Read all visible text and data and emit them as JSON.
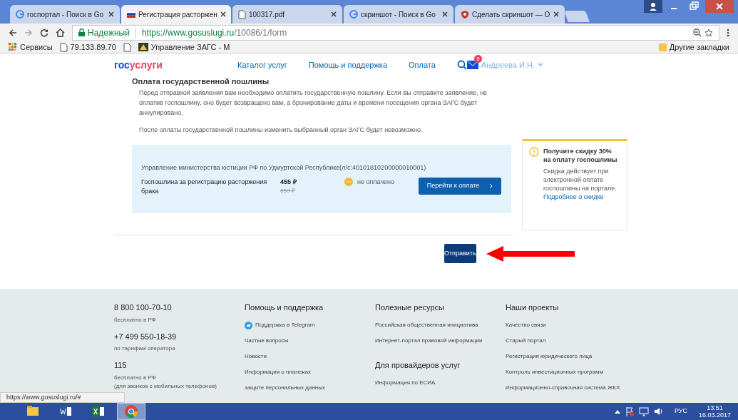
{
  "browser": {
    "tabs": [
      {
        "title": "госпортал - Поиск в Go",
        "kind": "google",
        "selected": false
      },
      {
        "title": "Регистрация расторжен",
        "kind": "flag",
        "selected": true
      },
      {
        "title": "100317.pdf",
        "kind": "file",
        "selected": false
      },
      {
        "title": "скриншот - Поиск в Go",
        "kind": "google",
        "selected": false
      },
      {
        "title": "Сделать скриншот — О",
        "kind": "shield",
        "selected": false
      }
    ],
    "address": {
      "secure_label": "Надежный",
      "url_host": "https://www.gosuslugi.ru",
      "url_path": "/10086/1/form"
    },
    "bookmarks": [
      {
        "label": "Сервисы",
        "kind": "apps"
      },
      {
        "label": "79.133.89.70",
        "kind": "file"
      },
      {
        "kind": "blank"
      },
      {
        "label": "Управление ЗАГС - М",
        "kind": "emblem"
      }
    ],
    "other_bookmarks": "Другие закладки"
  },
  "header": {
    "logo_a": "гос",
    "logo_b": "услуги",
    "nav": [
      "Каталог услуг",
      "Помощь и поддержка",
      "Оплата"
    ],
    "badge": "9",
    "user": "Андреева И.Н."
  },
  "section": {
    "heading": "Оплата государственной пошлины",
    "paragraphs": [
      "Перед отправкой заявления вам необходимо оплатить государственную пошлину. Если вы отправите заявление, не оплатив госпошлину, оно будет возвращено вам, а бронирование даты и времени посещения органа ЗАГС будет аннулировано.",
      "После оплаты государственной пошлины изменить выбранный орган ЗАГС будет невозможно."
    ],
    "payment": {
      "recipient": "Управление министерства юстиции РФ по Удмуртской Республике(л/с:40101810200000010001)",
      "item": "Госпошлина за регистрацию расторжения брака",
      "price": "455 ₽",
      "old_price": "650 ₽",
      "status": "не оплачено",
      "paid": false,
      "pay_button": "Перейти к оплате"
    },
    "discount": {
      "title": "Получите скидку 30% на оплату госпошлины",
      "text": "Скидка действует при электронной оплате госпошлины на портале.",
      "link": "Подробнее о скидке"
    },
    "submit": "Отправить"
  },
  "footer": {
    "contacts": [
      {
        "phone": "8 800 100-70-10",
        "note": "бесплатно в РФ"
      },
      {
        "phone": "+7 499 550-18-39",
        "note": "по тарифам оператора"
      },
      {
        "phone": "115",
        "note": "бесплатно в РФ",
        "note2": "(для звонков с мобильных телефонов)"
      }
    ],
    "columns": [
      {
        "title": "Помощь и поддержка",
        "links": [
          {
            "label": "Поддержка в Telegram",
            "kind": "telegram"
          },
          {
            "label": "Частые вопросы"
          },
          {
            "label": "Новости"
          },
          {
            "label": "Информация о платежах"
          },
          {
            "label": "защите персональных данных"
          }
        ]
      },
      {
        "title": "Полезные ресурсы",
        "links": [
          {
            "label": "Российская общественная инициатива"
          },
          {
            "label": "Интернет-портал правовой информации"
          }
        ],
        "title2": "Для провайдеров услуг",
        "links2": [
          {
            "label": "Информация по ЕСИА"
          }
        ]
      },
      {
        "title": "Наши проекты",
        "links": [
          {
            "label": "Качество связи"
          },
          {
            "label": "Старый портал"
          },
          {
            "label": "Регистрация юридического лица"
          },
          {
            "label": "Контроль инвестиционных программ"
          },
          {
            "label": "Информационно-справочная система ЖКХ"
          }
        ]
      }
    ]
  },
  "status_url": "https://www.gosuslugi.ru/#",
  "taskbar": {
    "apps": [
      {
        "kind": "folder",
        "selected": false
      },
      {
        "kind": "word",
        "selected": false
      },
      {
        "kind": "excel",
        "selected": false
      },
      {
        "kind": "chrome",
        "selected": true
      }
    ],
    "lang": "РУС",
    "time": "13:51",
    "date": "16.03.2017"
  }
}
